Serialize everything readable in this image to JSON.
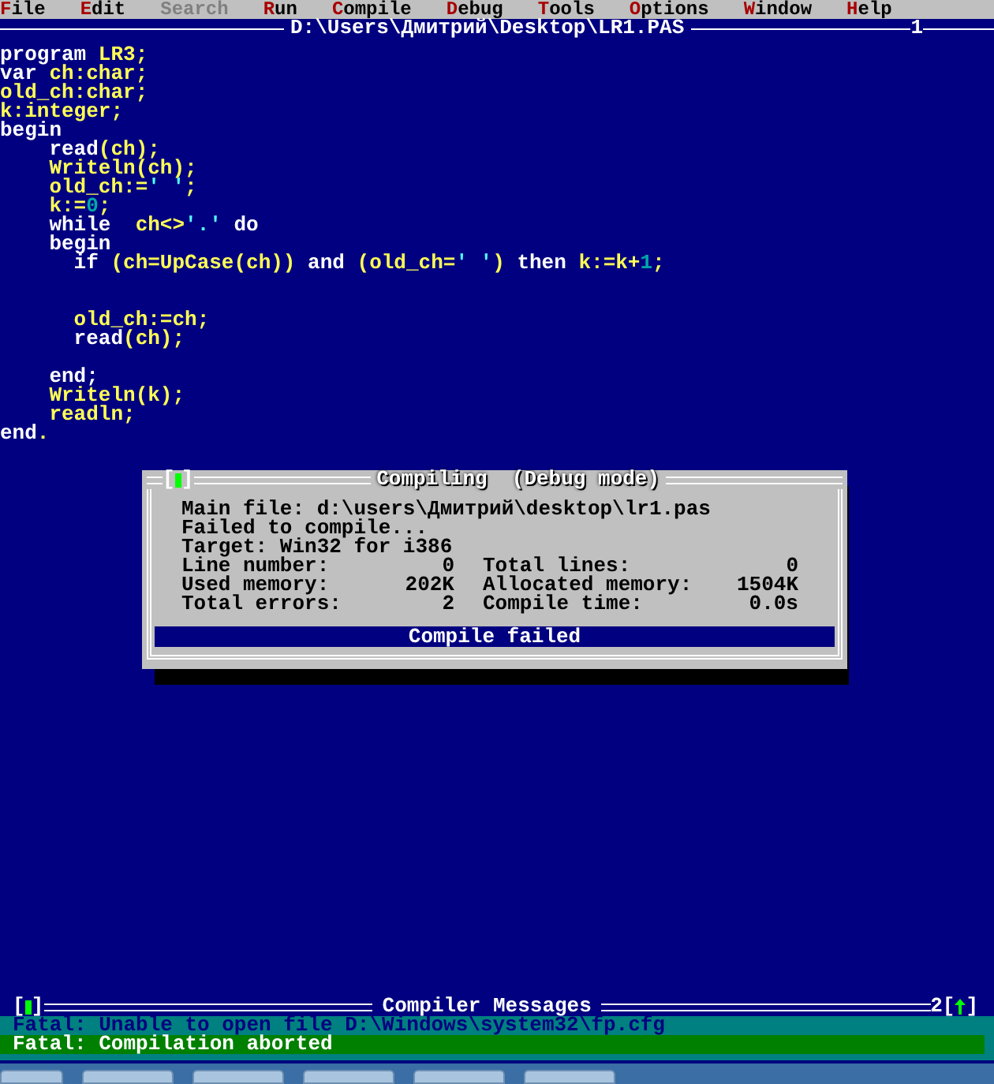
{
  "menu": [
    {
      "label": "File",
      "disabled": false
    },
    {
      "label": "Edit",
      "disabled": false
    },
    {
      "label": "Search",
      "disabled": true
    },
    {
      "label": "Run",
      "disabled": false
    },
    {
      "label": "Compile",
      "disabled": false
    },
    {
      "label": "Debug",
      "disabled": false
    },
    {
      "label": "Tools",
      "disabled": false
    },
    {
      "label": "Options",
      "disabled": false
    },
    {
      "label": "Window",
      "disabled": false
    },
    {
      "label": "Help",
      "disabled": false
    }
  ],
  "editor": {
    "title": "D:\\Users\\Дмитрий\\Desktop\\LR1.PAS",
    "number": "1",
    "lines": [
      {
        "kind": "code",
        "tokens": [
          {
            "kind": "keyword",
            "text": "program "
          },
          {
            "kind": "ident",
            "text": "LR3;"
          }
        ]
      },
      {
        "kind": "code",
        "tokens": [
          {
            "kind": "keyword",
            "text": "var "
          },
          {
            "kind": "ident",
            "text": "ch:char;"
          }
        ]
      },
      {
        "kind": "code",
        "tokens": [
          {
            "kind": "ident",
            "text": "old_ch:char;"
          }
        ]
      },
      {
        "kind": "code",
        "tokens": [
          {
            "kind": "ident",
            "text": "k:integer;"
          }
        ]
      },
      {
        "kind": "code",
        "tokens": [
          {
            "kind": "keyword",
            "text": "begin"
          }
        ]
      },
      {
        "kind": "code",
        "tokens": [
          {
            "kind": "keyword",
            "text": "    read"
          },
          {
            "kind": "ident",
            "text": "(ch);"
          }
        ]
      },
      {
        "kind": "code",
        "tokens": [
          {
            "kind": "ident",
            "text": "    Writeln(ch);"
          }
        ]
      },
      {
        "kind": "code",
        "tokens": [
          {
            "kind": "ident",
            "text": "    old_ch:="
          },
          {
            "kind": "string",
            "text": "' '"
          },
          {
            "kind": "ident",
            "text": ";"
          }
        ]
      },
      {
        "kind": "code",
        "tokens": [
          {
            "kind": "ident",
            "text": "    k:="
          },
          {
            "kind": "number",
            "text": "0"
          },
          {
            "kind": "ident",
            "text": ";"
          }
        ]
      },
      {
        "kind": "code",
        "tokens": [
          {
            "kind": "keyword",
            "text": "    while  "
          },
          {
            "kind": "ident",
            "text": "ch<>"
          },
          {
            "kind": "string",
            "text": "'.'"
          },
          {
            "kind": "keyword",
            "text": " do"
          }
        ]
      },
      {
        "kind": "code",
        "tokens": [
          {
            "kind": "keyword",
            "text": "    begin"
          }
        ]
      },
      {
        "kind": "code",
        "tokens": [
          {
            "kind": "keyword",
            "text": "      if "
          },
          {
            "kind": "ident",
            "text": "(ch=UpCase(ch)) "
          },
          {
            "kind": "keyword",
            "text": "and "
          },
          {
            "kind": "ident",
            "text": "(old_ch="
          },
          {
            "kind": "string",
            "text": "' '"
          },
          {
            "kind": "ident",
            "text": ") "
          },
          {
            "kind": "keyword",
            "text": "then "
          },
          {
            "kind": "ident",
            "text": "k:=k+"
          },
          {
            "kind": "number",
            "text": "1"
          },
          {
            "kind": "ident",
            "text": ";"
          }
        ]
      },
      {
        "kind": "blank"
      },
      {
        "kind": "blank"
      },
      {
        "kind": "code",
        "tokens": [
          {
            "kind": "ident",
            "text": "      old_ch:=ch;"
          }
        ]
      },
      {
        "kind": "code",
        "tokens": [
          {
            "kind": "keyword",
            "text": "      read"
          },
          {
            "kind": "ident",
            "text": "(ch);"
          }
        ]
      },
      {
        "kind": "blank"
      },
      {
        "kind": "code",
        "tokens": [
          {
            "kind": "keyword",
            "text": "    end;"
          }
        ]
      },
      {
        "kind": "code",
        "tokens": [
          {
            "kind": "ident",
            "text": "    Writeln(k);"
          }
        ]
      },
      {
        "kind": "code",
        "tokens": [
          {
            "kind": "ident",
            "text": "    readln;"
          }
        ]
      },
      {
        "kind": "code",
        "tokens": [
          {
            "kind": "keyword",
            "text": "end"
          },
          {
            "kind": "ident",
            "text": "."
          }
        ]
      }
    ]
  },
  "dialog": {
    "close_box": [
      "[",
      "]"
    ],
    "title": "Compiling  (Debug mode)",
    "lines": [
      "Main file: d:\\users\\Дмитрий\\desktop\\lr1.pas",
      "Failed to compile...",
      "Target: Win32 for i386"
    ],
    "stats": [
      [
        {
          "label": "Line number:",
          "value": "0"
        },
        {
          "label": "Total lines:",
          "value": "0"
        }
      ],
      [
        {
          "label": "Used memory:",
          "value": "202K"
        },
        {
          "label": "Allocated memory:",
          "value": "1504K"
        }
      ],
      [
        {
          "label": "Total errors:",
          "value": "2"
        },
        {
          "label": "Compile time:",
          "value": "0.0s"
        }
      ]
    ],
    "status": "Compile failed"
  },
  "messages_panel": {
    "close_box": [
      "[",
      "]"
    ],
    "title": "Compiler Messages",
    "number": "2",
    "zoom_box": [
      "[",
      "]"
    ],
    "messages": [
      {
        "text": "Fatal: Unable to open file D:\\Windows\\system32\\fp.cfg",
        "selected": false
      },
      {
        "text": "Fatal: Compilation aborted",
        "selected": true
      }
    ]
  }
}
